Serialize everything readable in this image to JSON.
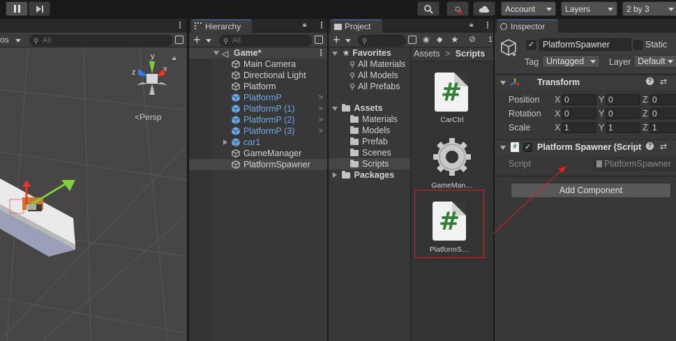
{
  "toolbar": {
    "account_label": "Account",
    "layers_label": "Layers",
    "layout_label": "2 by 3"
  },
  "scene": {
    "view_label": "Persp",
    "search_placeholder": "All",
    "gizmo_labels": {
      "x": "x",
      "y": "y",
      "z": "z"
    },
    "shading_label": "os"
  },
  "hierarchy": {
    "tab_label": "Hierarchy",
    "search_placeholder": "All",
    "scene_name": "Game*",
    "items": [
      {
        "label": "Main Camera",
        "prefab": false,
        "expandable": false,
        "selected": false
      },
      {
        "label": "Directional Light",
        "prefab": false,
        "expandable": false,
        "selected": false
      },
      {
        "label": "Platform",
        "prefab": false,
        "expandable": false,
        "selected": false
      },
      {
        "label": "PlatformP",
        "prefab": true,
        "expandable": true,
        "selected": false
      },
      {
        "label": "PlatformP (1)",
        "prefab": true,
        "expandable": true,
        "selected": false
      },
      {
        "label": "PlatformP (2)",
        "prefab": true,
        "expandable": true,
        "selected": false
      },
      {
        "label": "PlatformP (3)",
        "prefab": true,
        "expandable": true,
        "selected": false
      },
      {
        "label": "car1",
        "prefab": true,
        "expandable": false,
        "collapsed": true,
        "selected": false
      },
      {
        "label": "GameManager",
        "prefab": false,
        "expandable": false,
        "selected": false
      },
      {
        "label": "PlatformSpawner",
        "prefab": false,
        "expandable": false,
        "selected": true
      }
    ]
  },
  "project": {
    "tab_label": "Project",
    "favorites_label": "Favorites",
    "favorites": [
      "All Materials",
      "All Models",
      "All Prefabs"
    ],
    "assets_label": "Assets",
    "folders": [
      "Materials",
      "Models",
      "Prefab",
      "Scenes",
      "Scripts"
    ],
    "packages_label": "Packages",
    "breadcrumb": {
      "root": "Assets",
      "current": "Scripts"
    },
    "files": [
      {
        "name": "CarCtrl",
        "type": "script"
      },
      {
        "name": "GameMan…",
        "type": "gear"
      },
      {
        "name": "PlatformS…",
        "type": "script",
        "highlighted": true
      }
    ],
    "hidden_count": "1"
  },
  "inspector": {
    "tab_label": "Inspector",
    "object_name": "PlatformSpawner",
    "static_label": "Static",
    "tag_label": "Tag",
    "tag_value": "Untagged",
    "layer_label": "Layer",
    "layer_value": "Default",
    "transform": {
      "title": "Transform",
      "rows": [
        {
          "label": "Position",
          "x": "0",
          "y": "0",
          "z": "0"
        },
        {
          "label": "Rotation",
          "x": "0",
          "y": "0",
          "z": "0"
        },
        {
          "label": "Scale",
          "x": "1",
          "y": "1",
          "z": "1"
        }
      ]
    },
    "component": {
      "title": "Platform Spawner (Script",
      "script_label": "Script",
      "script_value": "PlatformSpawner"
    },
    "add_component_label": "Add Component"
  },
  "colors": {
    "accent_blue": "#3a79bb",
    "prefab_blue": "#6ea9e6",
    "annotation_red": "#e02020",
    "script_green": "#2e7d32"
  }
}
